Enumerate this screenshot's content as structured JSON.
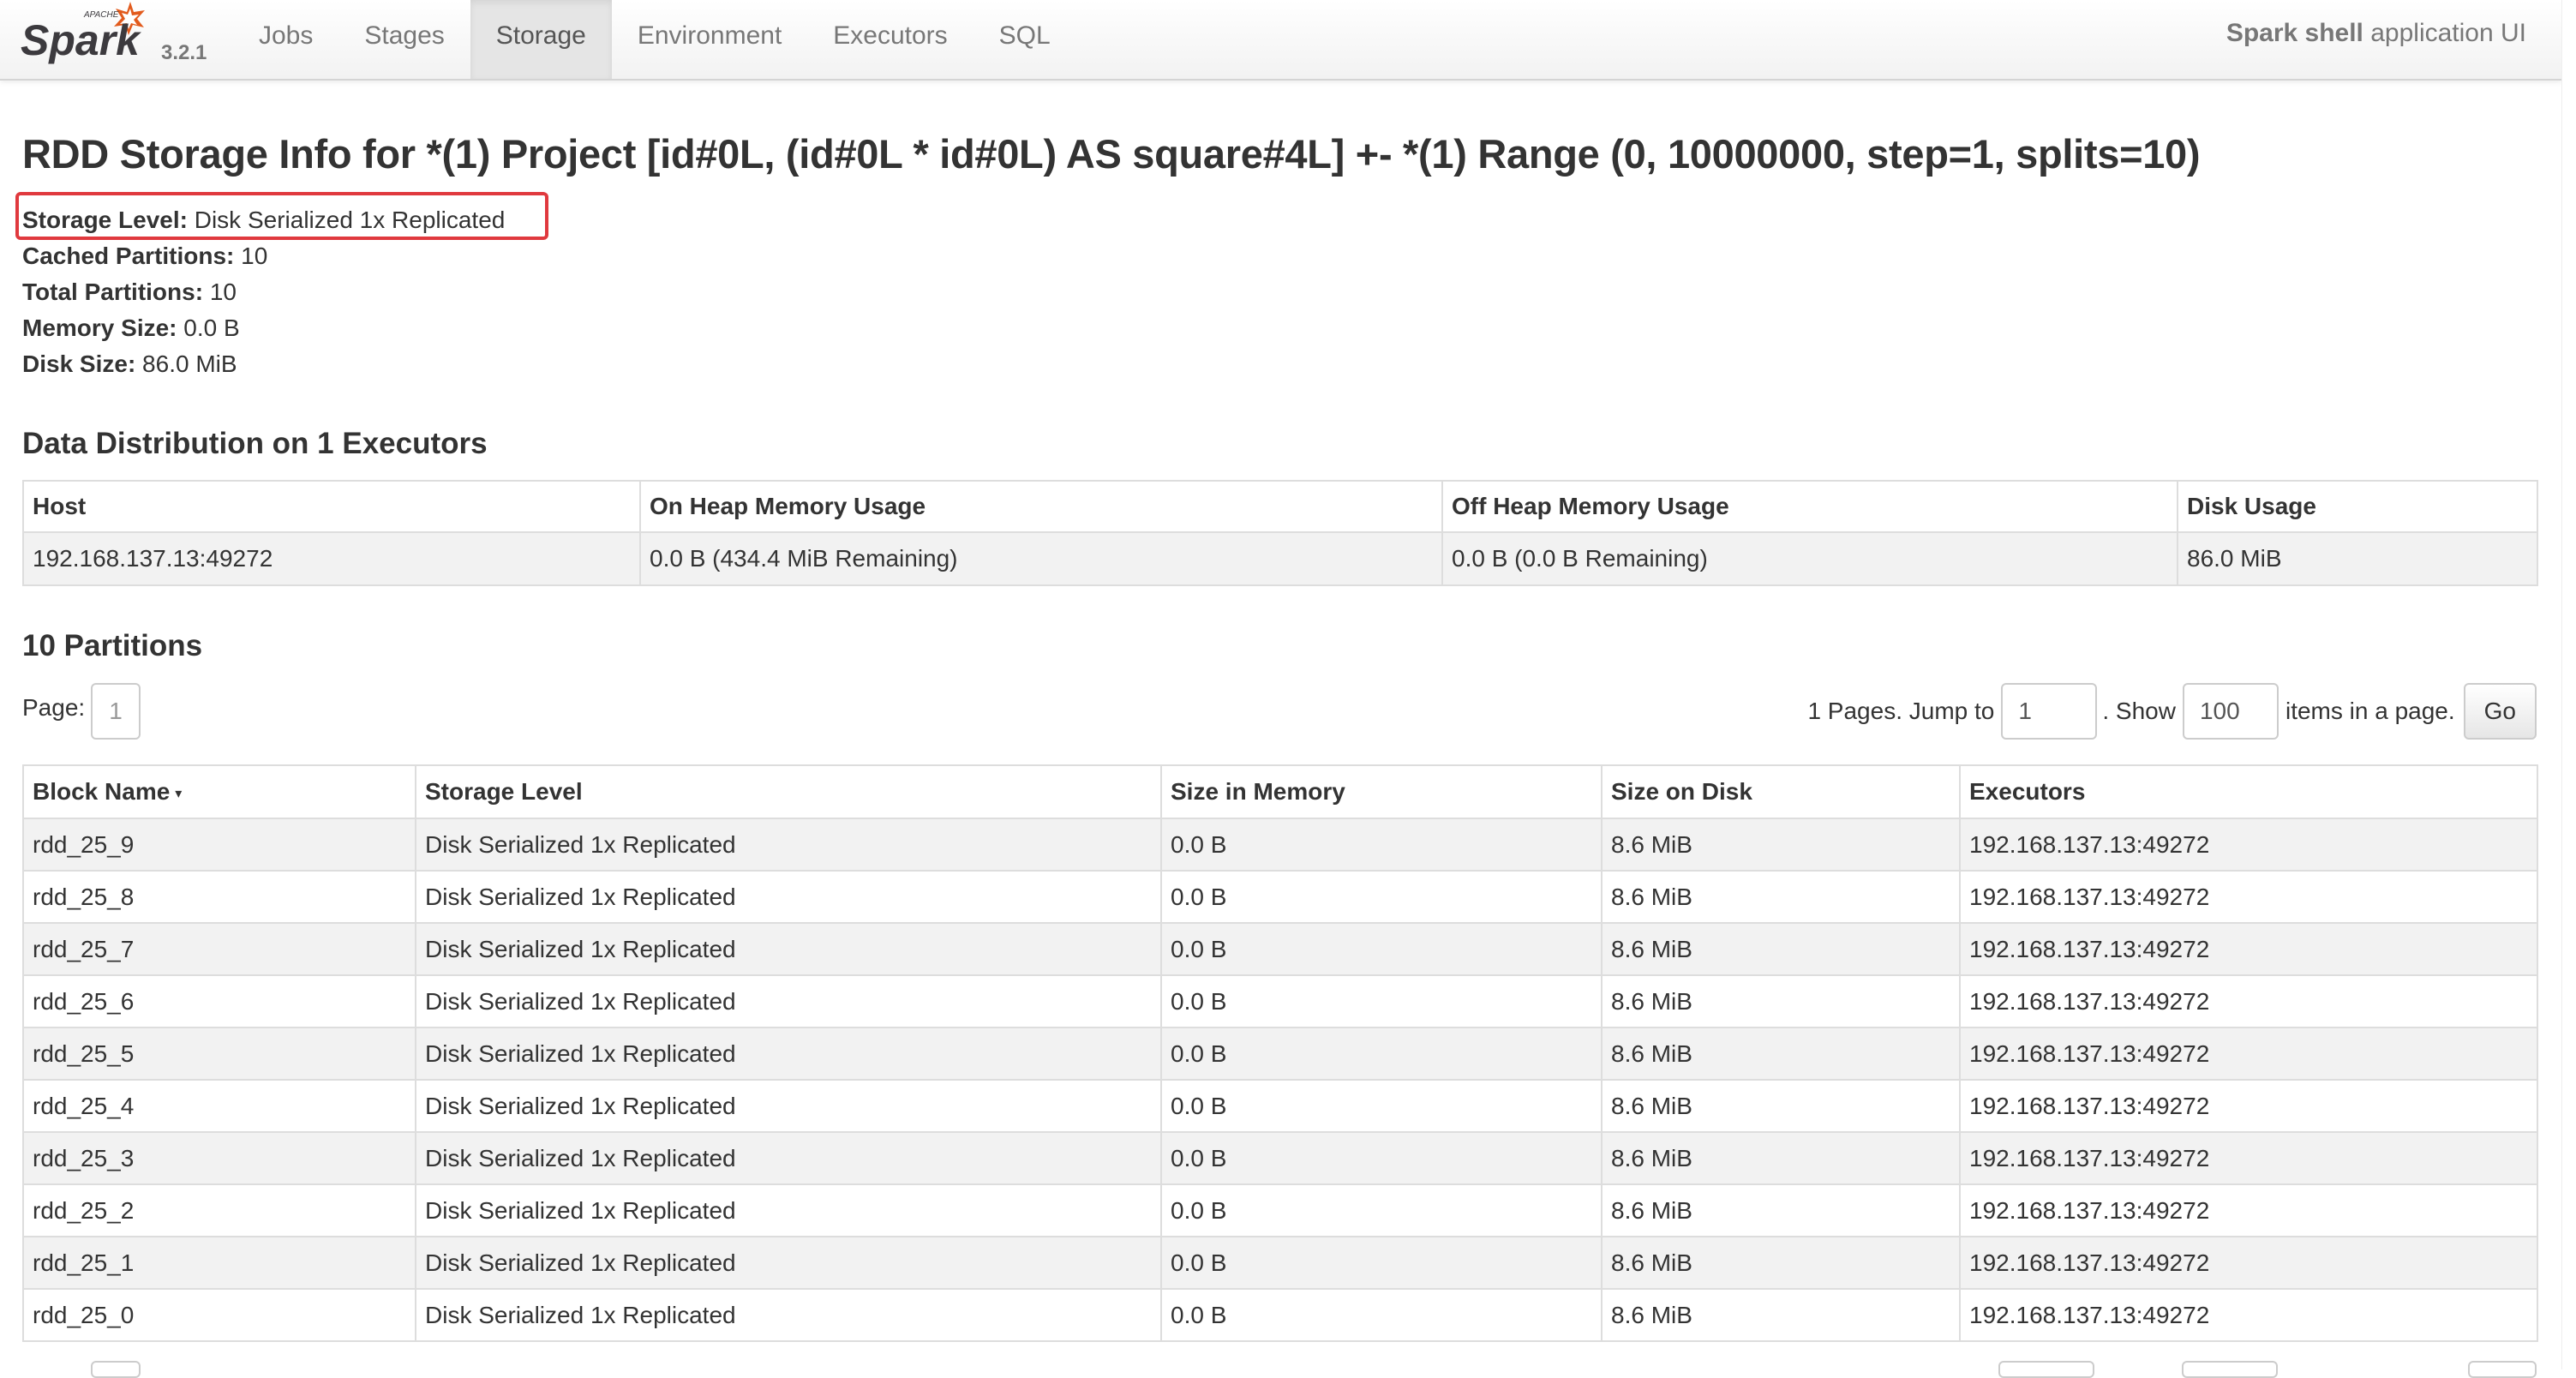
{
  "navbar": {
    "logo_apache": "APACHE",
    "logo_text": "Spark",
    "version": "3.2.1",
    "tabs": [
      {
        "label": "Jobs",
        "active": false
      },
      {
        "label": "Stages",
        "active": false
      },
      {
        "label": "Storage",
        "active": true
      },
      {
        "label": "Environment",
        "active": false
      },
      {
        "label": "Executors",
        "active": false
      },
      {
        "label": "SQL",
        "active": false
      }
    ],
    "app_name": "Spark shell",
    "app_suffix": " application UI"
  },
  "page": {
    "title": "RDD Storage Info for *(1) Project [id#0L, (id#0L * id#0L) AS square#4L] +- *(1) Range (0, 10000000, step=1, splits=10)"
  },
  "info": [
    {
      "label": "Storage Level:",
      "value": " Disk Serialized 1x Replicated"
    },
    {
      "label": "Cached Partitions:",
      "value": " 10"
    },
    {
      "label": "Total Partitions:",
      "value": " 10"
    },
    {
      "label": "Memory Size:",
      "value": " 0.0 B"
    },
    {
      "label": "Disk Size:",
      "value": " 86.0 MiB"
    }
  ],
  "distribution": {
    "title": "Data Distribution on 1 Executors",
    "headers": [
      "Host",
      "On Heap Memory Usage",
      "Off Heap Memory Usage",
      "Disk Usage"
    ],
    "rows": [
      [
        "192.168.137.13:49272",
        "0.0 B (434.4 MiB Remaining)",
        "0.0 B (0.0 B Remaining)",
        "86.0 MiB"
      ]
    ]
  },
  "partitions": {
    "title": "10 Partitions",
    "page_label": "Page:",
    "current_page": "1",
    "pages_text": "1 Pages. Jump to",
    "jump_value": "1",
    "show_text": ". Show",
    "show_value": "100",
    "items_text": "items in a page.",
    "go_label": "Go",
    "sort_indicator": "▾",
    "headers": [
      "Block Name",
      "Storage Level",
      "Size in Memory",
      "Size on Disk",
      "Executors"
    ],
    "rows": [
      [
        "rdd_25_9",
        "Disk Serialized 1x Replicated",
        "0.0 B",
        "8.6 MiB",
        "192.168.137.13:49272"
      ],
      [
        "rdd_25_8",
        "Disk Serialized 1x Replicated",
        "0.0 B",
        "8.6 MiB",
        "192.168.137.13:49272"
      ],
      [
        "rdd_25_7",
        "Disk Serialized 1x Replicated",
        "0.0 B",
        "8.6 MiB",
        "192.168.137.13:49272"
      ],
      [
        "rdd_25_6",
        "Disk Serialized 1x Replicated",
        "0.0 B",
        "8.6 MiB",
        "192.168.137.13:49272"
      ],
      [
        "rdd_25_5",
        "Disk Serialized 1x Replicated",
        "0.0 B",
        "8.6 MiB",
        "192.168.137.13:49272"
      ],
      [
        "rdd_25_4",
        "Disk Serialized 1x Replicated",
        "0.0 B",
        "8.6 MiB",
        "192.168.137.13:49272"
      ],
      [
        "rdd_25_3",
        "Disk Serialized 1x Replicated",
        "0.0 B",
        "8.6 MiB",
        "192.168.137.13:49272"
      ],
      [
        "rdd_25_2",
        "Disk Serialized 1x Replicated",
        "0.0 B",
        "8.6 MiB",
        "192.168.137.13:49272"
      ],
      [
        "rdd_25_1",
        "Disk Serialized 1x Replicated",
        "0.0 B",
        "8.6 MiB",
        "192.168.137.13:49272"
      ],
      [
        "rdd_25_0",
        "Disk Serialized 1x Replicated",
        "0.0 B",
        "8.6 MiB",
        "192.168.137.13:49272"
      ]
    ]
  },
  "colors": {
    "highlight": "#e0393e",
    "logo_orange": "#e25a1c",
    "logo_text": "#3c3a3e"
  }
}
